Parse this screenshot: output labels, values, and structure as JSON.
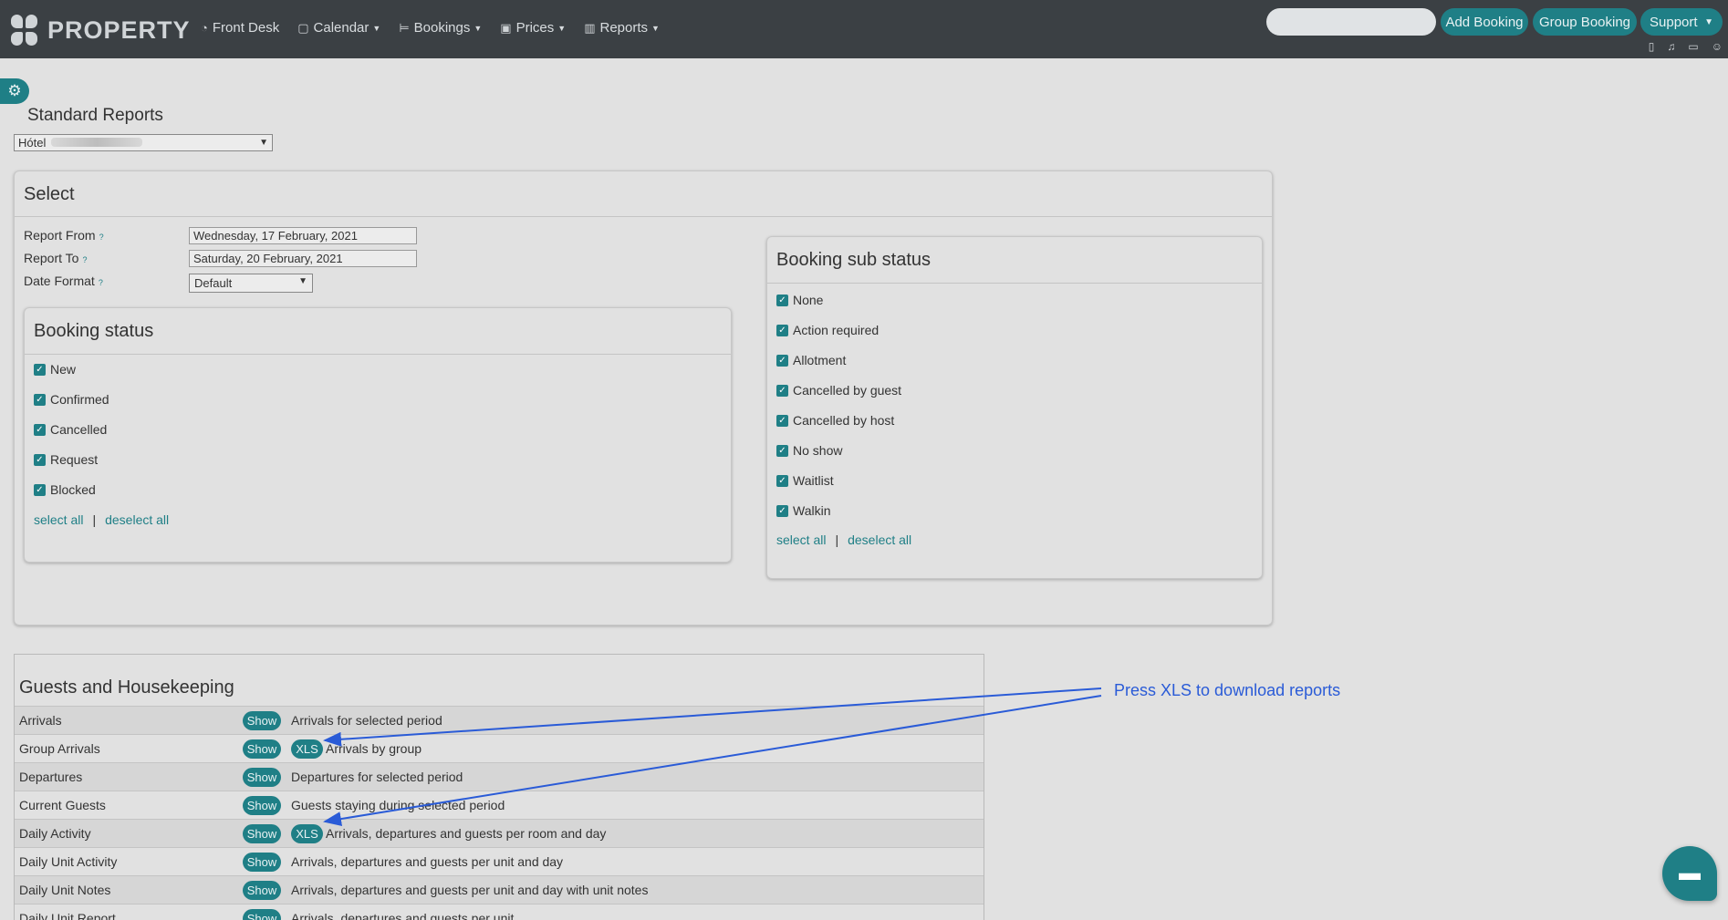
{
  "nav": {
    "brand": "PROPERTY",
    "items": [
      {
        "icon": "front-desk-icon",
        "glyph": "◔",
        "label": "Front Desk",
        "caret": false
      },
      {
        "icon": "calendar-icon",
        "glyph": "▢",
        "label": "Calendar",
        "caret": true
      },
      {
        "icon": "bed-icon",
        "glyph": "⊨",
        "label": "Bookings",
        "caret": true
      },
      {
        "icon": "money-icon",
        "glyph": "▣",
        "label": "Prices",
        "caret": true
      },
      {
        "icon": "chart-icon",
        "glyph": "▥",
        "label": "Reports",
        "caret": true
      }
    ],
    "search_placeholder": "",
    "add_booking": "Add Booking",
    "group_booking": "Group Booking",
    "support": "Support"
  },
  "page": {
    "title": "Standard Reports",
    "hotel_prefix": "Hótel"
  },
  "select": {
    "title": "Select",
    "report_from_label": "Report From",
    "report_from_value": "Wednesday, 17 February, 2021",
    "report_to_label": "Report To",
    "report_to_value": "Saturday, 20 February, 2021",
    "date_format_label": "Date Format",
    "date_format_value": "Default",
    "help_mark": "?"
  },
  "booking_status": {
    "title": "Booking status",
    "items": [
      "New",
      "Confirmed",
      "Cancelled",
      "Request",
      "Blocked"
    ],
    "select_all": "select all",
    "separator": "|",
    "deselect_all": "deselect all"
  },
  "booking_sub_status": {
    "title": "Booking sub status",
    "items": [
      "None",
      "Action required",
      "Allotment",
      "Cancelled by guest",
      "Cancelled by host",
      "No show",
      "Waitlist",
      "Walkin"
    ],
    "select_all": "select all",
    "separator": "|",
    "deselect_all": "deselect all"
  },
  "guests_housekeeping": {
    "title": "Guests and Housekeeping",
    "show_label": "Show",
    "xls_label": "XLS",
    "rows": [
      {
        "name": "Arrivals",
        "xls": false,
        "desc": "Arrivals for selected period"
      },
      {
        "name": "Group Arrivals",
        "xls": true,
        "desc": "Arrivals by group"
      },
      {
        "name": "Departures",
        "xls": false,
        "desc": "Departures for selected period"
      },
      {
        "name": "Current Guests",
        "xls": false,
        "desc": "Guests staying during selected period"
      },
      {
        "name": "Daily Activity",
        "xls": true,
        "desc": "Arrivals, departures and guests per room and day"
      },
      {
        "name": "Daily Unit Activity",
        "xls": false,
        "desc": "Arrivals, departures and guests per unit and day"
      },
      {
        "name": "Daily Unit Notes",
        "xls": false,
        "desc": "Arrivals, departures and guests per unit and day with unit notes"
      },
      {
        "name": "Daily Unit Report",
        "xls": false,
        "desc": "Arrivals, departures and guests per unit"
      }
    ]
  },
  "annotation": {
    "text": "Press XLS to download reports",
    "color": "#2a5bd7"
  },
  "colors": {
    "accent": "#1f7f86",
    "topbar": "#3b4044"
  }
}
